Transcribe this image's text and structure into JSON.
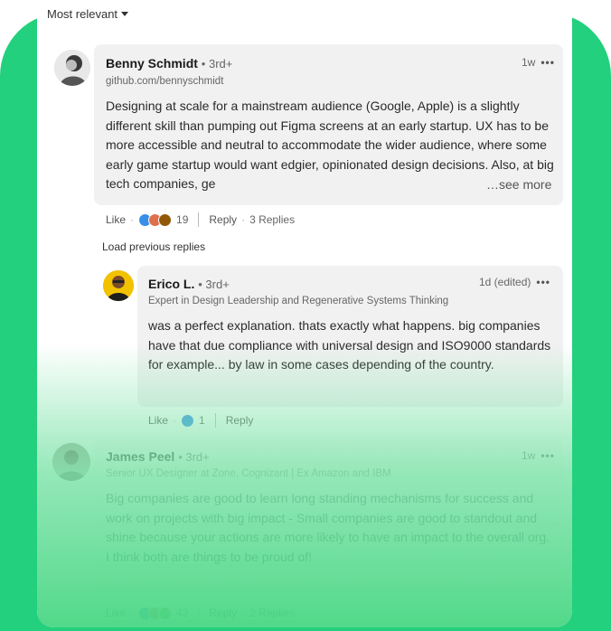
{
  "sort": {
    "label": "Most relevant"
  },
  "comments": [
    {
      "name": "Benny Schmidt",
      "degree": "• 3rd+",
      "headline": "github.com/bennyschmidt",
      "time": "1w",
      "text": "Designing at scale for a mainstream audience (Google, Apple) is a slightly different skill than pumping out Figma screens at an early startup. UX has to be more accessible and neutral to accommodate the wider audience, where some early game startup would want edgier, opinionated design decisions. Also, at big tech companies, ge",
      "see_more": "…see more",
      "like_label": "Like",
      "reaction_count": "19",
      "reply_label": "Reply",
      "replies_label": "3 Replies"
    },
    {
      "name": "Erico L.",
      "degree": "• 3rd+",
      "headline": "Expert in Design Leadership and Regenerative Systems Thinking",
      "time": "1d (edited)",
      "text": "was a perfect explanation. thats exactly what happens. big companies have that due compliance with universal design and ISO9000 standards for example... by law in some cases depending of the country.",
      "like_label": "Like",
      "reaction_count": "1",
      "reply_label": "Reply"
    },
    {
      "name": "James Peel",
      "degree": "• 3rd+",
      "headline": "Senior UX Designer at Zone, Cognizant | Ex Amazon and IBM",
      "time": "1w",
      "text_line1": "Big companies are good to learn long standing mechanisms for success and work on projects with big impact - Small companies are good to standout and shine because your actions are more likely to have an impact to the overall org.",
      "text_line2": "I think both are things to be proud of!",
      "like_label": "Like",
      "reaction_count": "42",
      "reply_label": "Reply",
      "replies_label": "2 Replies"
    }
  ],
  "load_previous": "Load previous replies",
  "separator": "·",
  "more_dots": "•••",
  "colors": {
    "accent_green": "#22d07d",
    "bubble": "#f1f1f1"
  }
}
